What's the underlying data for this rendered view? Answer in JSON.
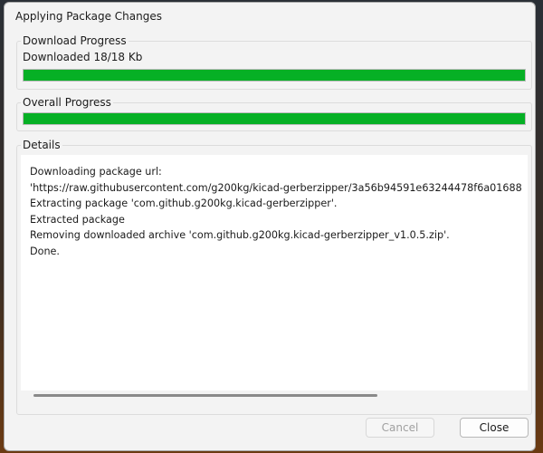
{
  "window": {
    "title": "Applying Package Changes"
  },
  "download": {
    "group_label": "Download Progress",
    "status": "Downloaded 18/18 Kb",
    "progress_fraction": 1.0
  },
  "overall": {
    "group_label": "Overall Progress",
    "progress_fraction": 1.0
  },
  "details": {
    "group_label": "Details",
    "lines": [
      "Downloading package url:",
      "'https://raw.githubusercontent.com/g200kg/kicad-gerberzipper/3a56b94591e63244478f6a01688",
      "Extracting package 'com.github.g200kg.kicad-gerberzipper'.",
      "Extracted package",
      "Removing downloaded archive 'com.github.g200kg.kicad-gerberzipper_v1.0.5.zip'.",
      "Done."
    ]
  },
  "buttons": {
    "cancel": "Cancel",
    "close": "Close"
  },
  "colors": {
    "progress_fill": "#06b025",
    "dialog_bg": "#f3f3f3"
  }
}
